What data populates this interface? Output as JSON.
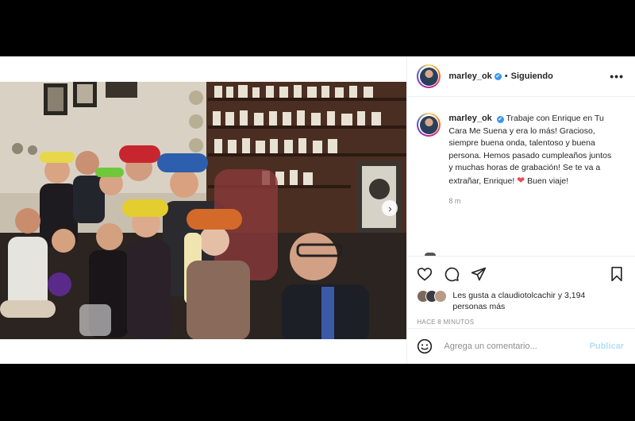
{
  "post": {
    "username": "marley_ok",
    "follow_status": "Siguiendo",
    "separator": "•",
    "more_label": "•••",
    "verified_mark": "✔",
    "caption": "Trabaje con Enrique en Tu Cara Me Suena y era lo más! Gracioso, siempre buena onda, talentoso y buena persona. Hemos pasado cumpleaños juntos y muchas horas de grabación! Se te va a extrañar, Enrique!",
    "caption_heart": "❤",
    "caption_end": "Buen viaje!",
    "time_ago": "8 m",
    "likes_text": "Les gusta a",
    "likes_user": "claudiotolcachir",
    "likes_and": "y",
    "likes_others": "3,194 personas más",
    "posted_time": "HACE 8 MINUTOS",
    "carousel_next": "›",
    "carousel": {
      "slides": 6,
      "active_index": 0
    }
  },
  "comment": {
    "placeholder": "Agrega un comentario...",
    "publish_label": "Publicar"
  },
  "icons": {
    "like": "heart-icon",
    "comment": "comment-icon",
    "share": "send-icon",
    "save": "bookmark-icon",
    "emoji": "emoji-icon",
    "tag": "user-tag-icon"
  },
  "colors": {
    "accent": "#3897f0",
    "publish_disabled": "#b2dffc",
    "heart": "#ed4956",
    "muted_text": "#8e8e8e"
  }
}
